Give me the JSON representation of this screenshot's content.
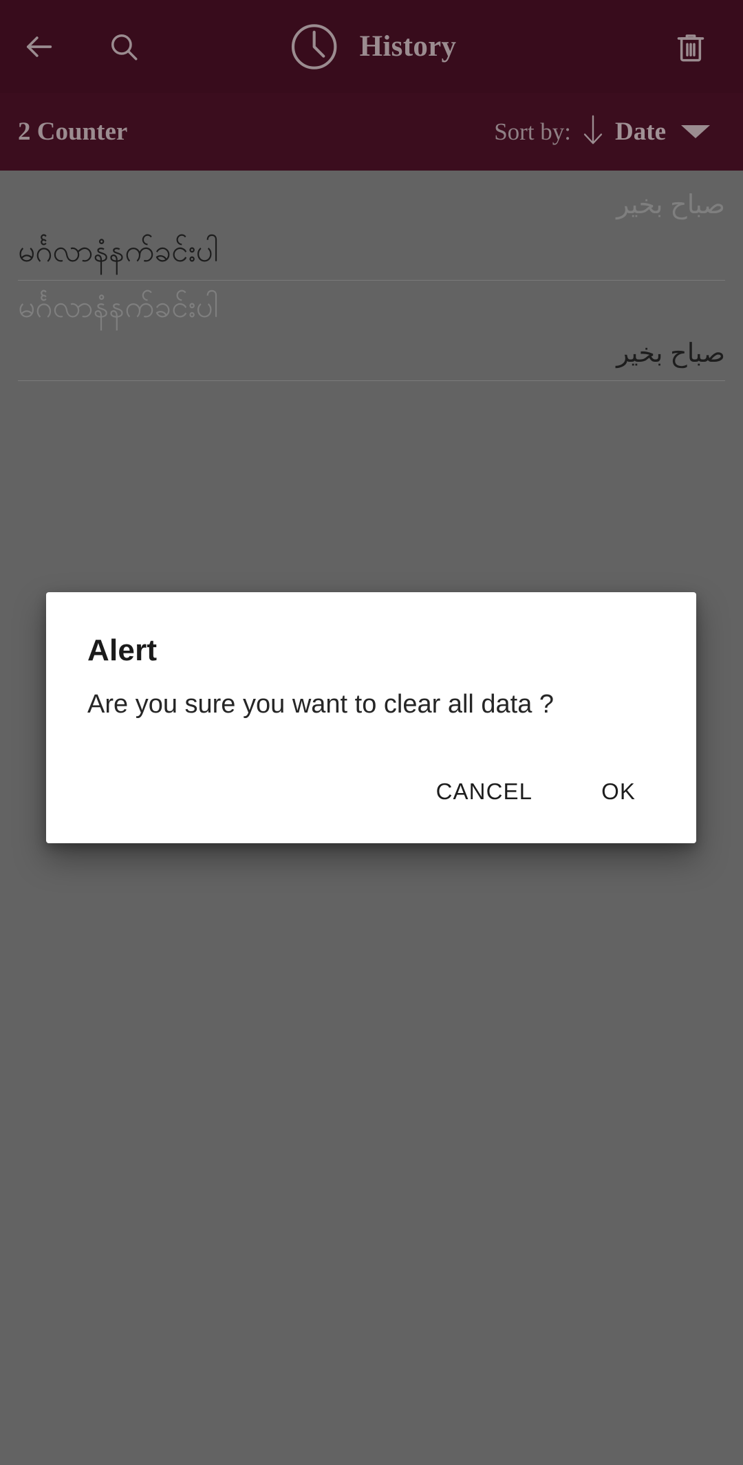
{
  "toolbar": {
    "back_icon": "arrow-left-icon",
    "search_icon": "search-icon",
    "history_icon": "clock-icon",
    "title": "History",
    "delete_icon": "trash-icon",
    "background_color": "#380c1c",
    "icon_color": "#9b8c90"
  },
  "sortbar": {
    "counter": "2 Counter",
    "sort_by_label": "Sort by:",
    "sort_direction_icon": "arrow-down-icon",
    "sort_value": "Date",
    "dropdown_icon": "caret-down-icon",
    "background_color": "#3b0d1e"
  },
  "history": {
    "items": [
      {
        "source_text": "صباح بخير",
        "source_dir": "rtl",
        "target_text": "မင်္ဂလာနံနက်ခင်းပါ",
        "target_dir": "ltr"
      },
      {
        "source_text": "မင်္ဂလာနံနက်ခင်းပါ",
        "source_dir": "ltr",
        "target_text": "صباح بخير",
        "target_dir": "rtl"
      }
    ]
  },
  "dialog": {
    "title": "Alert",
    "message": "Are you sure you want to clear all data ?",
    "cancel_label": "CANCEL",
    "ok_label": "OK",
    "background_color": "#ffffff"
  },
  "scrim": {
    "color": "#636363"
  }
}
